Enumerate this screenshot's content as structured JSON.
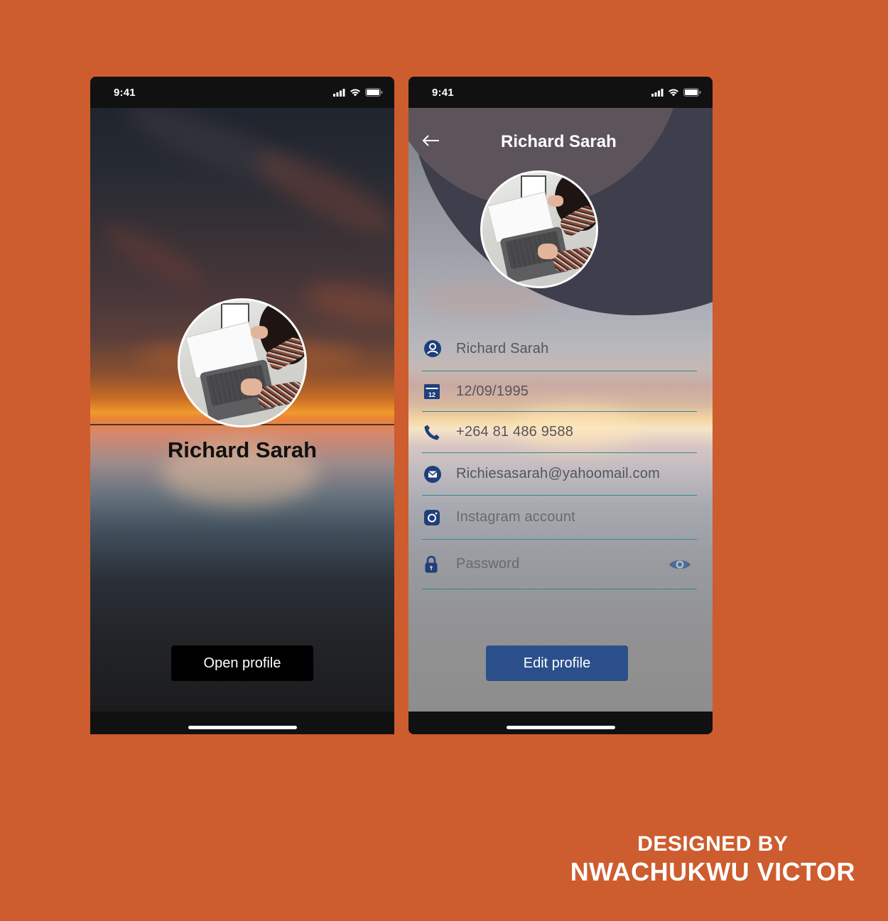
{
  "colors": {
    "background": "#cd5c2e",
    "accent_blue": "#2b4f8a",
    "field_underline": "#2f8c8f",
    "icon_blue": "#1f3f7a"
  },
  "status_bar": {
    "time": "9:41",
    "icons": [
      "signal-icon",
      "wifi-icon",
      "battery-icon"
    ]
  },
  "screen1": {
    "name": "Richard Sarah",
    "open_button_label": "Open profile"
  },
  "screen2": {
    "title": "Richard Sarah",
    "back_icon": "back-arrow-icon",
    "fields": {
      "name": {
        "icon": "user-icon",
        "value": "Richard Sarah"
      },
      "dob": {
        "icon": "calendar-icon",
        "icon_text": "12",
        "value": "12/09/1995"
      },
      "phone": {
        "icon": "phone-icon",
        "value": "+264 81  486 9588"
      },
      "email": {
        "icon": "mail-icon",
        "value": "Richiesasarah@yahoomail.com"
      },
      "instagram": {
        "icon": "instagram-icon",
        "placeholder": "Instagram account"
      },
      "password": {
        "icon": "lock-icon",
        "placeholder": "Password",
        "toggle_icon": "eye-icon"
      }
    },
    "edit_button_label": "Edit profile"
  },
  "credit": {
    "line1": "DESIGNED BY",
    "line2": "NWACHUKWU VICTOR"
  }
}
